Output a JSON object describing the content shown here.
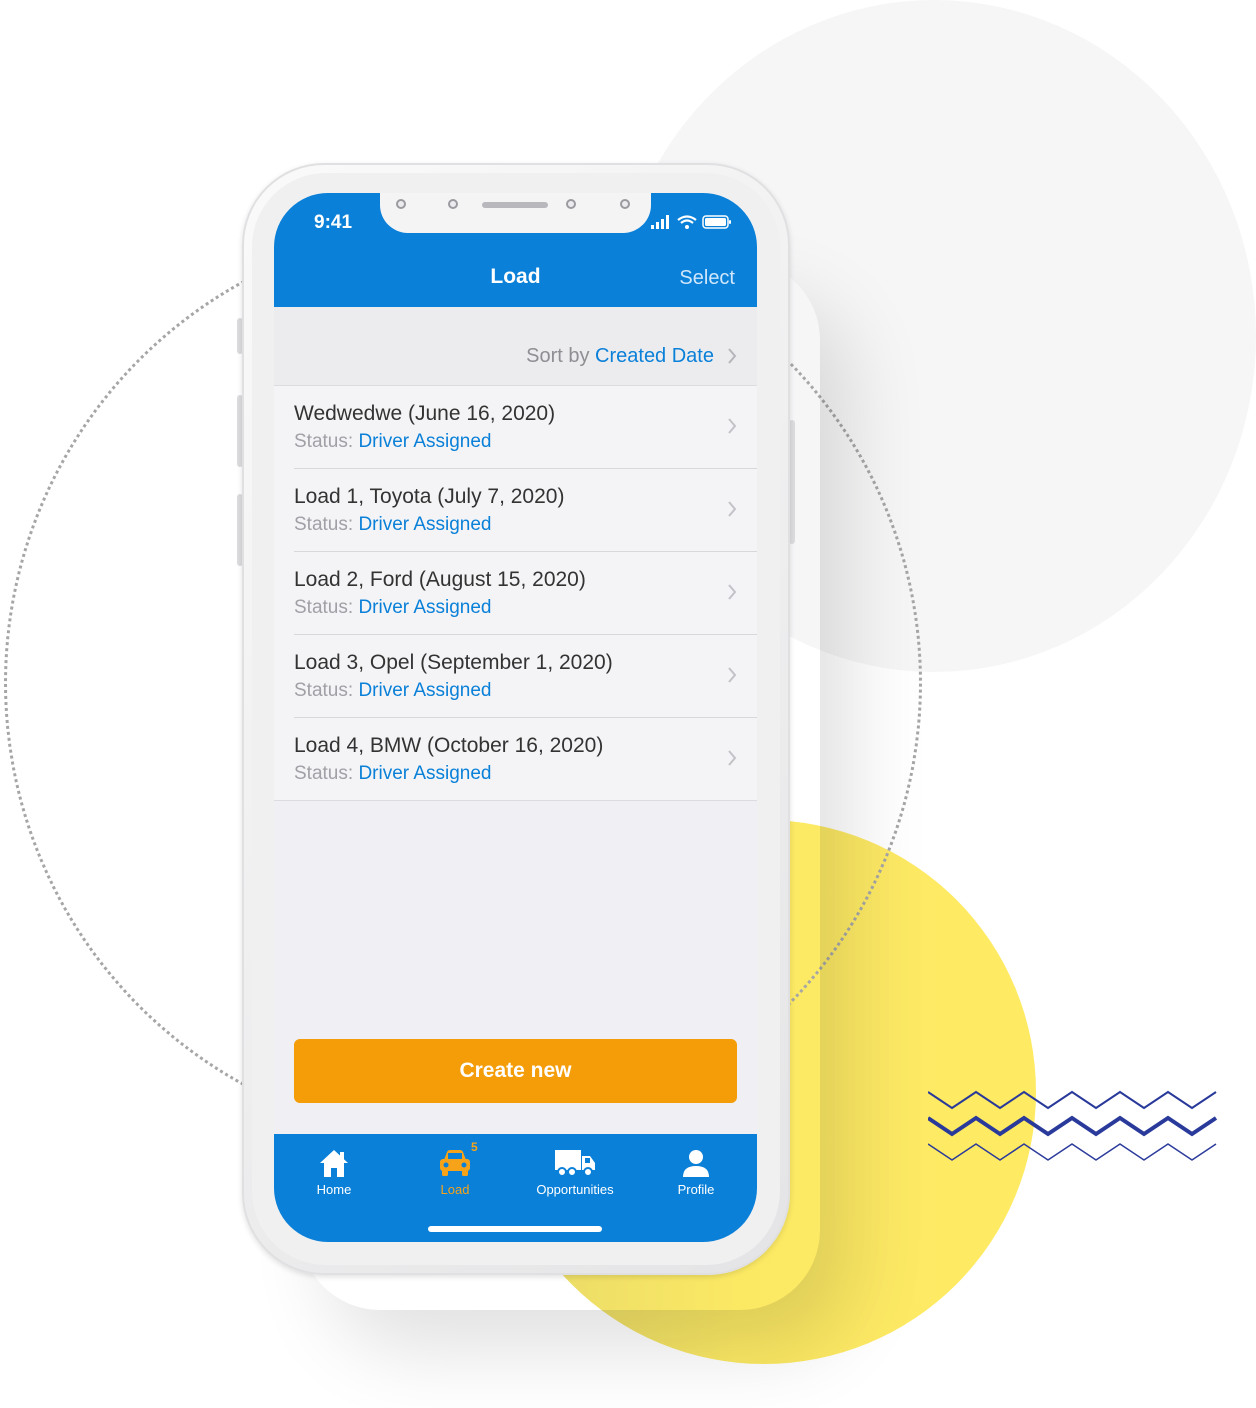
{
  "status_bar": {
    "time": "9:41"
  },
  "nav": {
    "title": "Load",
    "select_label": "Select"
  },
  "sort": {
    "label": "Sort by",
    "value": "Created Date"
  },
  "loads": [
    {
      "title": "Wedwedwe (June 16, 2020)",
      "status_label": "Status:",
      "status_value": "Driver Assigned"
    },
    {
      "title": "Load 1, Toyota (July 7, 2020)",
      "status_label": "Status:",
      "status_value": "Driver Assigned"
    },
    {
      "title": "Load 2, Ford (August 15, 2020)",
      "status_label": "Status:",
      "status_value": "Driver Assigned"
    },
    {
      "title": "Load 3, Opel (September 1, 2020)",
      "status_label": "Status:",
      "status_value": "Driver Assigned"
    },
    {
      "title": "Load 4, BMW (October 16, 2020)",
      "status_label": "Status:",
      "status_value": "Driver Assigned"
    }
  ],
  "create_button": {
    "label": "Create new"
  },
  "tabs": [
    {
      "label": "Home",
      "icon": "home-icon",
      "active": false
    },
    {
      "label": "Load",
      "icon": "car-icon",
      "active": true,
      "badge": "5"
    },
    {
      "label": "Opportunities",
      "icon": "truck-icon",
      "active": false
    },
    {
      "label": "Profile",
      "icon": "person-icon",
      "active": false
    }
  ],
  "colors": {
    "primary": "#0a80d8",
    "accent": "#f49d09",
    "active_tab": "#f6a31a",
    "background": "#efeff4",
    "decor_yellow": "#ffea63",
    "decor_navy": "#2a3a9a"
  }
}
